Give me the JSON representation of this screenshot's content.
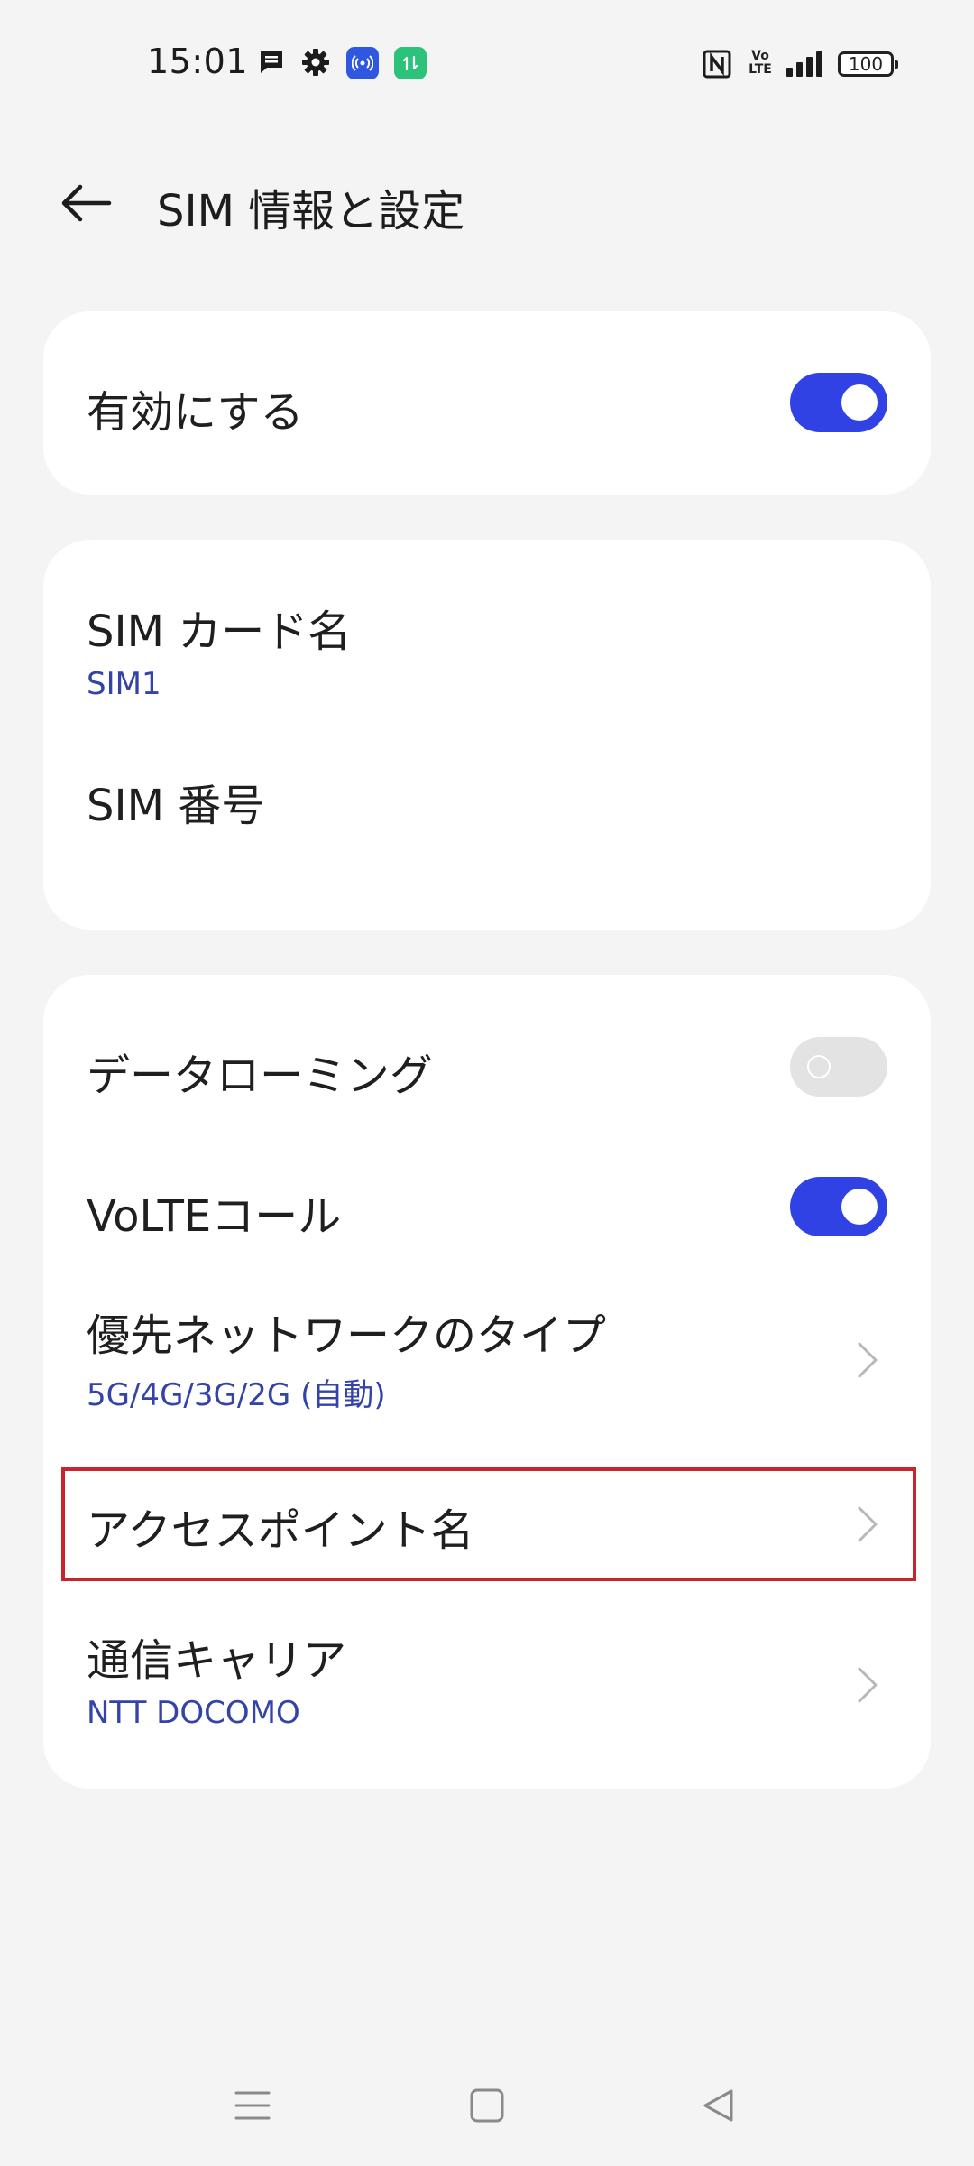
{
  "status_bar": {
    "time": "15:01",
    "battery": "100",
    "volte_top": "Vo",
    "volte_bottom": "LTE",
    "icons": [
      "message-icon",
      "gear-icon",
      "hotspot-icon",
      "data-transfer-icon",
      "nfc-icon",
      "volte-icon",
      "signal-icon",
      "battery-icon"
    ]
  },
  "header": {
    "back_icon": "arrow-left-icon",
    "title": "SIM 情報と設定"
  },
  "card_enable": {
    "label": "有効にする",
    "enabled": true
  },
  "card_sim": {
    "name_label": "SIM カード名",
    "name_value": "SIM1",
    "number_label": "SIM 番号"
  },
  "card_network": {
    "roaming_label": "データローミング",
    "roaming_enabled": false,
    "volte_label": "VoLTEコール",
    "volte_enabled": true,
    "network_type_label": "優先ネットワークのタイプ",
    "network_type_value": "5G/4G/3G/2G (自動)",
    "apn_label": "アクセスポイント名",
    "carrier_label": "通信キャリア",
    "carrier_value": "NTT DOCOMO"
  },
  "colors": {
    "accent": "#3042e4",
    "subtext": "#3443a8",
    "highlight": "#c8242c",
    "background": "#f4f4f4"
  },
  "nav_bar": {
    "icons": [
      "menu-icon",
      "home-icon",
      "back-triangle-icon"
    ]
  }
}
